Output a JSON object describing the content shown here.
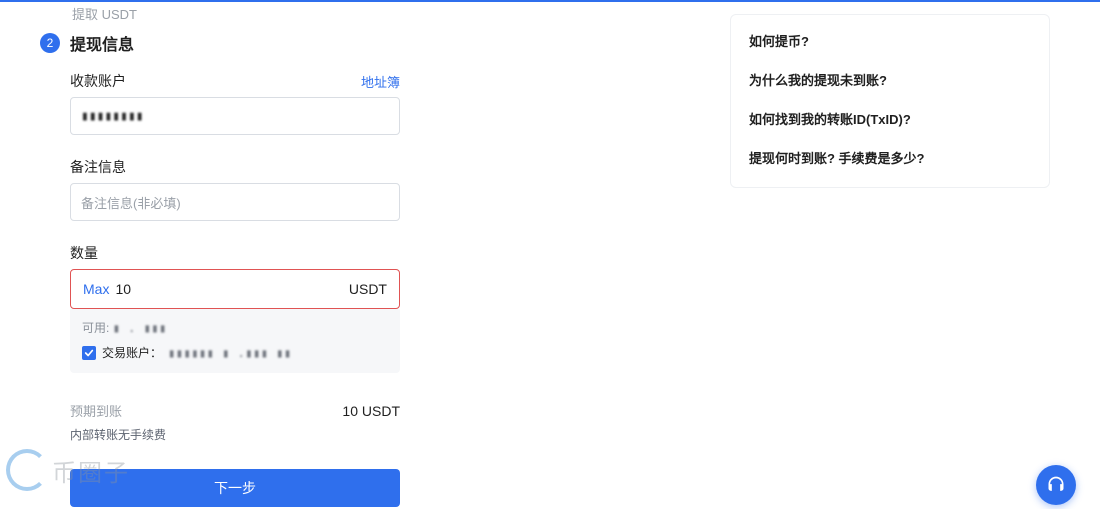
{
  "breadcrumb": "提取 USDT",
  "step": {
    "num": "2",
    "title": "提现信息"
  },
  "recipient": {
    "label": "收款账户",
    "address_book": "地址簿",
    "value_masked": "▮▮▮▮▮▮▮▮"
  },
  "memo": {
    "label": "备注信息",
    "placeholder": "备注信息(非必填)"
  },
  "amount": {
    "label": "数量",
    "max_label": "Max",
    "value": "10",
    "unit": "USDT"
  },
  "available": {
    "label": "可用:",
    "value_masked": "▮ . ▮▮▮"
  },
  "trade_account": {
    "checked": true,
    "label": "交易账户：",
    "value_masked": "▮▮▮▮▮▮ ▮ .▮▮▮ ▮▮"
  },
  "expected": {
    "label": "预期到账",
    "value": "10 USDT",
    "fee_note": "内部转账无手续费"
  },
  "next_button": "下一步",
  "faq": {
    "items": [
      "如何提币?",
      "为什么我的提现未到账?",
      "如何找到我的转账ID(TxID)?",
      "提现何时到账? 手续费是多少?"
    ]
  },
  "watermark": "币圈子"
}
